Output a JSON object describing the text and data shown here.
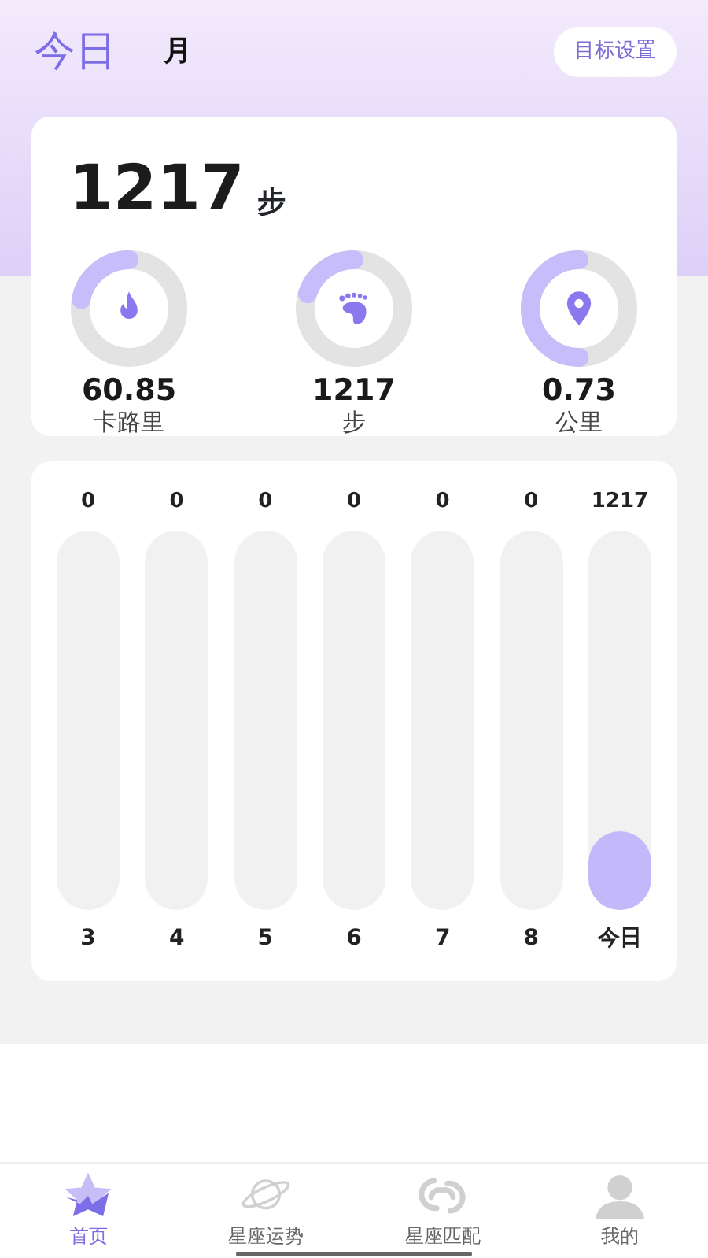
{
  "header": {
    "tabs": [
      {
        "label": "今日",
        "selected": true
      },
      {
        "label": "月",
        "selected": false
      }
    ],
    "goal_button": "目标设置"
  },
  "summary": {
    "steps": "1217",
    "unit": "步",
    "stats": [
      {
        "kind": "fire",
        "value": "60.85",
        "label": "卡路里",
        "level": 0.22
      },
      {
        "kind": "foot",
        "value": "1217",
        "label": "步",
        "level": 0.2
      },
      {
        "kind": "pin",
        "value": "0.73",
        "label": "公里",
        "level": 0.5
      }
    ]
  },
  "bars": [
    {
      "value": "0",
      "day": "3",
      "level": 0
    },
    {
      "value": "0",
      "day": "4",
      "level": 0
    },
    {
      "value": "0",
      "day": "5",
      "level": 0
    },
    {
      "value": "0",
      "day": "6",
      "level": 0
    },
    {
      "value": "0",
      "day": "7",
      "level": 0
    },
    {
      "value": "0",
      "day": "8",
      "level": 0
    },
    {
      "value": "1217",
      "day": "今日",
      "level": 0.2
    }
  ],
  "tab_bar": [
    {
      "kind": "star",
      "label": "首页",
      "selected": true
    },
    {
      "kind": "planet",
      "label": "星座运势",
      "selected": false
    },
    {
      "kind": "swirl",
      "label": "星座匹配",
      "selected": false
    },
    {
      "kind": "person",
      "label": "我的",
      "selected": false
    }
  ]
}
